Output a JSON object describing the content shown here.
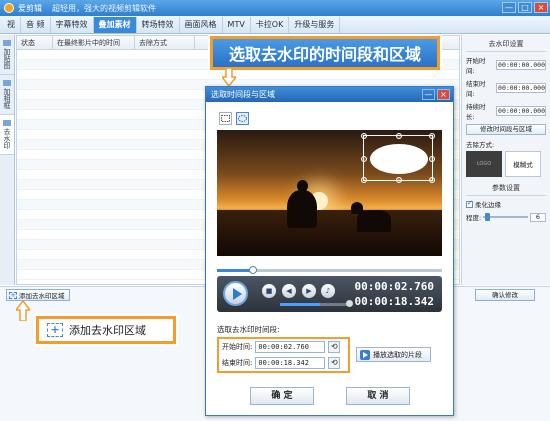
{
  "window": {
    "app_name": "爱剪辑",
    "slogan": "超轻用，强大的视频剪辑软件",
    "min": "—",
    "max": "□",
    "close": "×"
  },
  "menu": [
    "视",
    "音 频",
    "字幕特效",
    "叠加素材",
    "转场特效",
    "画面风格",
    "MTV",
    "卡拉OK",
    "升级与服务"
  ],
  "left_tabs": [
    {
      "label": "加贴图"
    },
    {
      "label": "加相框"
    },
    {
      "label": "去水印"
    }
  ],
  "list": {
    "columns": [
      "状态",
      "在最终影片中的时间",
      "去除方式"
    ]
  },
  "right_panel": {
    "title": "去水印设置",
    "start_label": "开始时间:",
    "start_value": "00:00:00.000",
    "end_label": "结束时间:",
    "end_value": "00:00:00.000",
    "duration_label": "持续时长:",
    "duration_value": "00:00:00.000",
    "edit_button": "修改时间段与区域",
    "method_label": "去除方式:",
    "thumb_text": "LOGO",
    "method_value": "模糊式",
    "params_title": "参数设置",
    "soften_label": "柔化边缘",
    "level_label": "程度:",
    "level_value": "6"
  },
  "bottom": {
    "add_button": "添加去水印区域",
    "confirm_button": "确认修改"
  },
  "callouts": {
    "top": "选取去水印的时间段和区域",
    "bottom": "添加去水印区域"
  },
  "dialog": {
    "title": "选取时间段与区域",
    "current_time": "00:00:02.760",
    "total_time": "00:00:18.342",
    "section_label": "选取去水印时间段:",
    "start_label": "开始时间:",
    "start_value": "00:00:02.760",
    "end_label": "结束时间:",
    "end_value": "00:00:18.342",
    "play_button": "播放选取的片段",
    "ok": "确 定",
    "cancel": "取 消"
  }
}
